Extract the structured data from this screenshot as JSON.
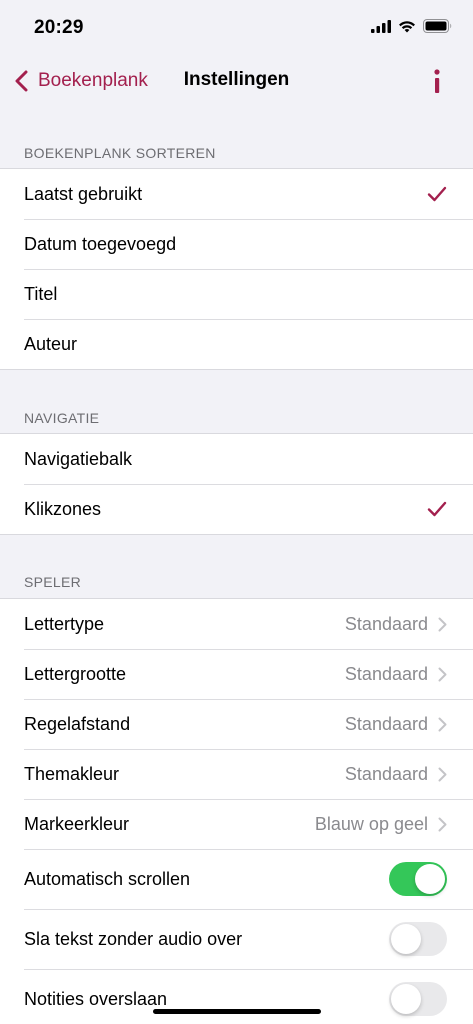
{
  "status_bar": {
    "time": "20:29"
  },
  "nav": {
    "back_label": "Boekenplank",
    "title": "Instellingen",
    "info_label": "i"
  },
  "colors": {
    "accent": "#a3204e",
    "toggle_on": "#34c759",
    "toggle_off": "#e9e9eb"
  },
  "sections": {
    "sort": {
      "header": "BOEKENPLANK SORTEREN",
      "items": [
        {
          "label": "Laatst gebruikt",
          "checked": true
        },
        {
          "label": "Datum toegevoegd",
          "checked": false
        },
        {
          "label": "Titel",
          "checked": false
        },
        {
          "label": "Auteur",
          "checked": false
        }
      ]
    },
    "navigation": {
      "header": "NAVIGATIE",
      "items": [
        {
          "label": "Navigatiebalk",
          "checked": false
        },
        {
          "label": "Klikzones",
          "checked": true
        }
      ]
    },
    "player": {
      "header": "SPELER",
      "items": [
        {
          "label": "Lettertype",
          "value": "Standaard"
        },
        {
          "label": "Lettergrootte",
          "value": "Standaard"
        },
        {
          "label": "Regelafstand",
          "value": "Standaard"
        },
        {
          "label": "Themakleur",
          "value": "Standaard"
        },
        {
          "label": "Markeerkleur",
          "value": "Blauw op geel"
        }
      ],
      "toggles": [
        {
          "label": "Automatisch scrollen",
          "on": true
        },
        {
          "label": "Sla tekst zonder audio over",
          "on": false
        },
        {
          "label": "Notities overslaan",
          "on": false
        }
      ]
    }
  }
}
